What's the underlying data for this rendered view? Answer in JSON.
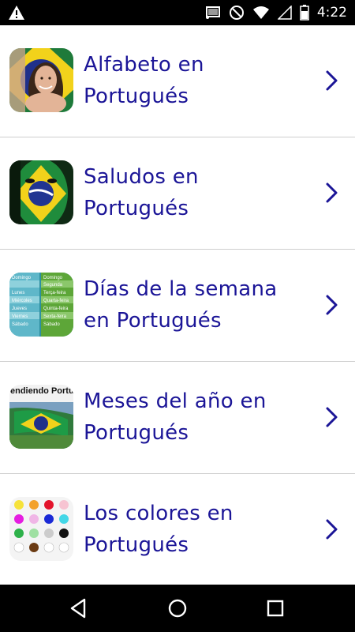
{
  "status_bar": {
    "time": "4:22",
    "icons": [
      "warning-icon",
      "cast-icon",
      "do-not-disturb-icon",
      "wifi-icon",
      "signal-icon",
      "battery-icon"
    ]
  },
  "items": [
    {
      "label": "Alfabeto en Portugués",
      "thumbnail": "girl-brazil-flag-thumbnail"
    },
    {
      "label": "Saludos en Portugués",
      "thumbnail": "face-painted-flag-thumbnail"
    },
    {
      "label": "Días de la semana en Portugués",
      "thumbnail": "weekdays-chart-thumbnail",
      "thumb_text": [
        "Domingo",
        "Lunes",
        "Miércoles",
        "Jueves",
        "Viernes",
        "Sábado",
        "Domingo",
        "Segunda",
        "Terça-feira",
        "Quarta-feira",
        "Quinta-feira",
        "Sexta-feira",
        "Sábado"
      ]
    },
    {
      "label": "Meses del año en Portugués",
      "thumbnail": "aprendiendo-portugues-thumbnail",
      "thumb_text": "endiendo Portugu"
    },
    {
      "label": "Los colores en Portugués",
      "thumbnail": "color-palette-thumbnail"
    }
  ],
  "colors": {
    "label": "#1b1597",
    "divider": "#cfcfcf"
  },
  "nav_bar": {
    "buttons": [
      "back-icon",
      "home-icon",
      "recents-icon"
    ]
  }
}
